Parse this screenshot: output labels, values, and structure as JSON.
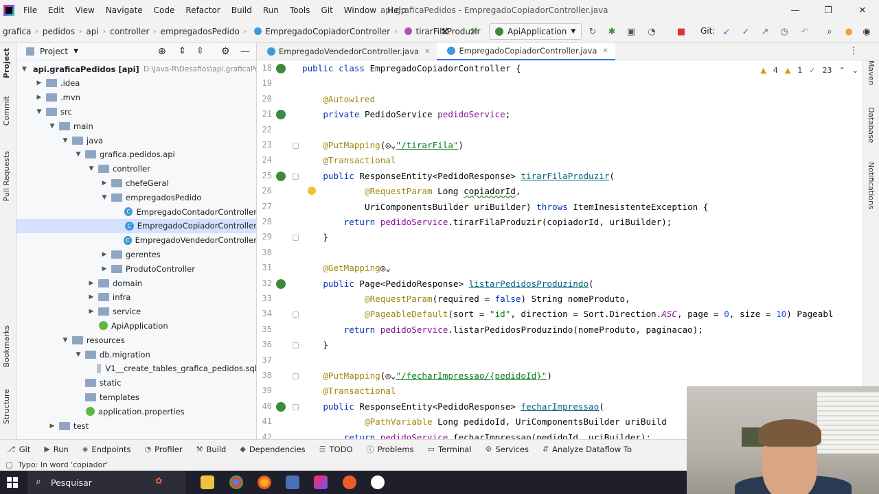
{
  "menubar": {
    "items": [
      "File",
      "Edit",
      "View",
      "Navigate",
      "Code",
      "Refactor",
      "Build",
      "Run",
      "Tools",
      "Git",
      "Window",
      "Help"
    ],
    "window_title": "api.graficaPedidos - EmpregadoCopiadorController.java"
  },
  "breadcrumb": [
    "grafica",
    "pedidos",
    "api",
    "controller",
    "empregadosPedido",
    "EmpregadoCopiadorController",
    "tirarFilaProduzir"
  ],
  "run_config": "ApiApplication",
  "git_label": "Git:",
  "project_panel": {
    "title": "Project",
    "tree": [
      {
        "label": "api.graficaPedidos [api]",
        "extra": "D:\\Java-R\\Desafios\\api.graficaPedid",
        "depth": 0,
        "arrow": "open",
        "icon": "folder"
      },
      {
        "label": ".idea",
        "depth": 1,
        "arrow": "closed",
        "icon": "folder"
      },
      {
        "label": ".mvn",
        "depth": 1,
        "arrow": "closed",
        "icon": "folder"
      },
      {
        "label": "src",
        "depth": 1,
        "arrow": "open",
        "icon": "folder"
      },
      {
        "label": "main",
        "depth": 2,
        "arrow": "open",
        "icon": "folder"
      },
      {
        "label": "java",
        "depth": 3,
        "arrow": "open",
        "icon": "folder"
      },
      {
        "label": "grafica.pedidos.api",
        "depth": 4,
        "arrow": "open",
        "icon": "folder"
      },
      {
        "label": "controller",
        "depth": 5,
        "arrow": "open",
        "icon": "folder"
      },
      {
        "label": "chefeGeral",
        "depth": 6,
        "arrow": "closed",
        "icon": "folder"
      },
      {
        "label": "empregadosPedido",
        "depth": 6,
        "arrow": "open",
        "icon": "folder"
      },
      {
        "label": "EmpregadoContadorController",
        "depth": 7,
        "arrow": "",
        "icon": "class"
      },
      {
        "label": "EmpregadoCopiadorController",
        "depth": 7,
        "arrow": "",
        "icon": "class",
        "selected": true
      },
      {
        "label": "EmpregadoVendedorController",
        "depth": 7,
        "arrow": "",
        "icon": "class"
      },
      {
        "label": "gerentes",
        "depth": 6,
        "arrow": "closed",
        "icon": "folder"
      },
      {
        "label": "ProdutoController",
        "depth": 6,
        "arrow": "closed",
        "icon": "folder"
      },
      {
        "label": "domain",
        "depth": 5,
        "arrow": "closed",
        "icon": "folder"
      },
      {
        "label": "infra",
        "depth": 5,
        "arrow": "closed",
        "icon": "folder"
      },
      {
        "label": "service",
        "depth": 5,
        "arrow": "closed",
        "icon": "folder"
      },
      {
        "label": "ApiApplication",
        "depth": 5,
        "arrow": "",
        "icon": "spring"
      },
      {
        "label": "resources",
        "depth": 3,
        "arrow": "open",
        "icon": "folder"
      },
      {
        "label": "db.migration",
        "depth": 4,
        "arrow": "open",
        "icon": "folder"
      },
      {
        "label": "V1__create_tables_grafica_pedidos.sql",
        "depth": 5,
        "arrow": "",
        "icon": "file"
      },
      {
        "label": "static",
        "depth": 4,
        "arrow": "",
        "icon": "folder"
      },
      {
        "label": "templates",
        "depth": 4,
        "arrow": "",
        "icon": "folder"
      },
      {
        "label": "application.properties",
        "depth": 4,
        "arrow": "",
        "icon": "spring"
      },
      {
        "label": "test",
        "depth": 2,
        "arrow": "closed",
        "icon": "folder"
      }
    ]
  },
  "tabs": [
    {
      "label": "EmpregadoVendedorController.java",
      "active": false
    },
    {
      "label": "EmpregadoCopiadorController.java",
      "active": true
    }
  ],
  "inspections": {
    "warnings": "4",
    "weak": "1",
    "ok": "23"
  },
  "left_strip": [
    "Project",
    "Commit",
    "Pull Requests",
    "Bookmarks",
    "Structure"
  ],
  "right_strip": [
    "Maven",
    "Database",
    "Notifications"
  ],
  "bottom_tools": [
    "Git",
    "Run",
    "Endpoints",
    "Profiler",
    "Build",
    "Dependencies",
    "TODO",
    "Problems",
    "Terminal",
    "Services",
    "Analyze Dataflow To"
  ],
  "status_text": "Typo: In word 'copiador'",
  "taskbar": {
    "search_placeholder": "Pesquisar"
  }
}
